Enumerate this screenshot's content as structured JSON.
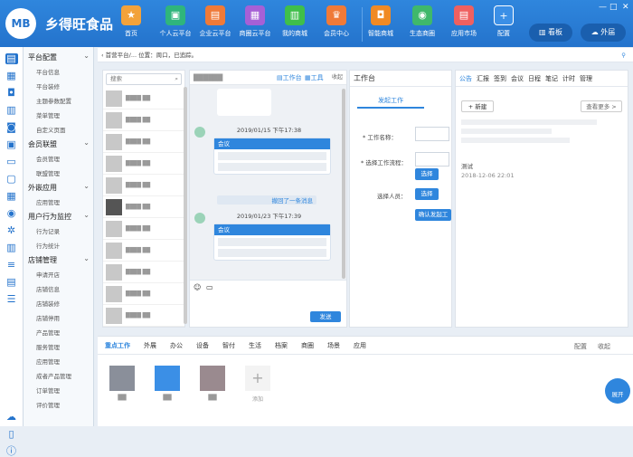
{
  "header": {
    "logo": "MB",
    "brand": "乡得旺食品",
    "nav": [
      {
        "label": "首页",
        "icon": "trophy-icon",
        "glyph": "★",
        "color": "#f2a23a"
      },
      {
        "label": "个人云平台",
        "icon": "monitor-icon",
        "glyph": "▣",
        "color": "#2fb57c"
      },
      {
        "label": "企业云平台",
        "icon": "briefcase-icon",
        "glyph": "▤",
        "color": "#ef7a38"
      },
      {
        "label": "商圈云平台",
        "icon": "screen-icon",
        "glyph": "▦",
        "color": "#a660d6"
      },
      {
        "label": "我的商城",
        "icon": "shop-icon",
        "glyph": "▥",
        "color": "#3fbf4a"
      },
      {
        "label": "会员中心",
        "icon": "crown-icon",
        "glyph": "♛",
        "color": "#ef7a38"
      },
      {
        "label": "智能商城",
        "icon": "bag-icon",
        "glyph": "◘",
        "color": "#f08a25"
      },
      {
        "label": "生态商圈",
        "icon": "palette-icon",
        "glyph": "◉",
        "color": "#3fb86b"
      },
      {
        "label": "应用市场",
        "icon": "store-icon",
        "glyph": "▤",
        "color": "#ef6060"
      },
      {
        "label": "配置",
        "icon": "plus-icon",
        "glyph": "+",
        "color": "#3b8fe6"
      }
    ],
    "btn_board": "看板",
    "btn_deploy": "外届"
  },
  "sidebar": {
    "groups": [
      {
        "label": "平台配置",
        "items": [
          "平台信息",
          "平台装修",
          "主题参数配置",
          "菜单管理",
          "自定义页面"
        ]
      },
      {
        "label": "会员联盟",
        "items": [
          "会员管理",
          "联盟管理"
        ]
      },
      {
        "label": "外嵌应用",
        "items": [
          "应用管理"
        ]
      },
      {
        "label": "用户行为监控",
        "items": [
          "行为记录",
          "行为统计"
        ]
      },
      {
        "label": "店铺管理",
        "items": [
          "申请开店",
          "店铺信息",
          "店铺装修",
          "店铺停用",
          "产品管理",
          "服务管理",
          "应用管理",
          "成者产品管理",
          "订单管理",
          "评价管理"
        ]
      }
    ]
  },
  "breadcrumb": "首营平台/...   位置：周口，已追踪。",
  "chat_list": {
    "search_placeholder": "搜索"
  },
  "chat_window": {
    "tool_work": "工作台",
    "tool_tools": "工具",
    "tool_collapse": "收起",
    "time1": "2019/01/15 下午17:38",
    "time2": "2019/01/23 下午17:39",
    "bubble_title": "会议",
    "recall_notice": "撤回了一条消息",
    "send": "发送"
  },
  "workbench": {
    "title": "工作台",
    "tab": "发起工作",
    "f_name": "* 工作名称：",
    "f_flow": "* 选择工作流程：",
    "f_person": "选择人员：",
    "choose": "选择",
    "confirm": "确认发起工",
    "lit": "ⓘ"
  },
  "notice": {
    "tabs": [
      "公告",
      "汇报",
      "签到",
      "会议",
      "日程",
      "笔记",
      "计时",
      "管理"
    ],
    "new_btn": "+ 新建",
    "more": "查看更多 >",
    "test_title": "测试",
    "test_meta": "2018-12-06 22:01"
  },
  "bottom": {
    "tabs": [
      "重点工作",
      "外展",
      "办公",
      "设备",
      "智付",
      "生活",
      "档案",
      "商圈",
      "场景",
      "应用"
    ],
    "config": "配置",
    "collapse": "收起",
    "add": "添加",
    "expand": "展开"
  }
}
